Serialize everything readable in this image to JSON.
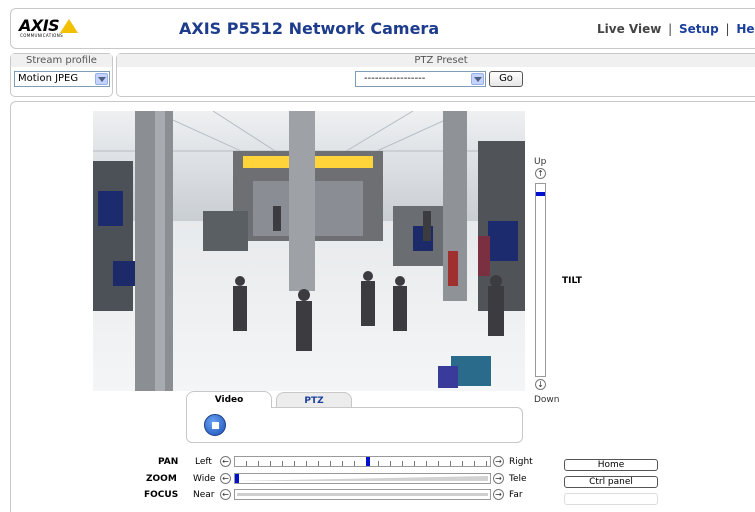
{
  "header": {
    "logo_text": "AXIS",
    "logo_sub": "COMMUNICATIONS",
    "title": "AXIS P5512 Network Camera",
    "nav": {
      "live_view": "Live View",
      "separator": "|",
      "setup": "Setup",
      "help": "Help"
    }
  },
  "stream_profile": {
    "label": "Stream profile",
    "value": "Motion JPEG"
  },
  "ptz_preset": {
    "label": "PTZ Preset",
    "value": "-----------------",
    "go_label": "Go"
  },
  "tilt": {
    "up_label": "Up",
    "down_label": "Down",
    "label": "TILT",
    "position": 0.04
  },
  "tabs": [
    {
      "label": "Video",
      "active": true
    },
    {
      "label": "PTZ",
      "active": false
    }
  ],
  "pan": {
    "label": "PAN",
    "low": "Left",
    "high": "Right",
    "position": 0.52
  },
  "zoom": {
    "label": "ZOOM",
    "low": "Wide",
    "high": "Tele",
    "position": 0.0
  },
  "focus": {
    "label": "FOCUS",
    "low": "Near",
    "high": "Far"
  },
  "buttons": {
    "home": "Home",
    "ctrl_panel": "Ctrl panel"
  },
  "colors": {
    "title": "#1e3c8c",
    "link": "#1a3f9c",
    "logo_yellow": "#f2c000",
    "slider_thumb": "#0010d0"
  }
}
